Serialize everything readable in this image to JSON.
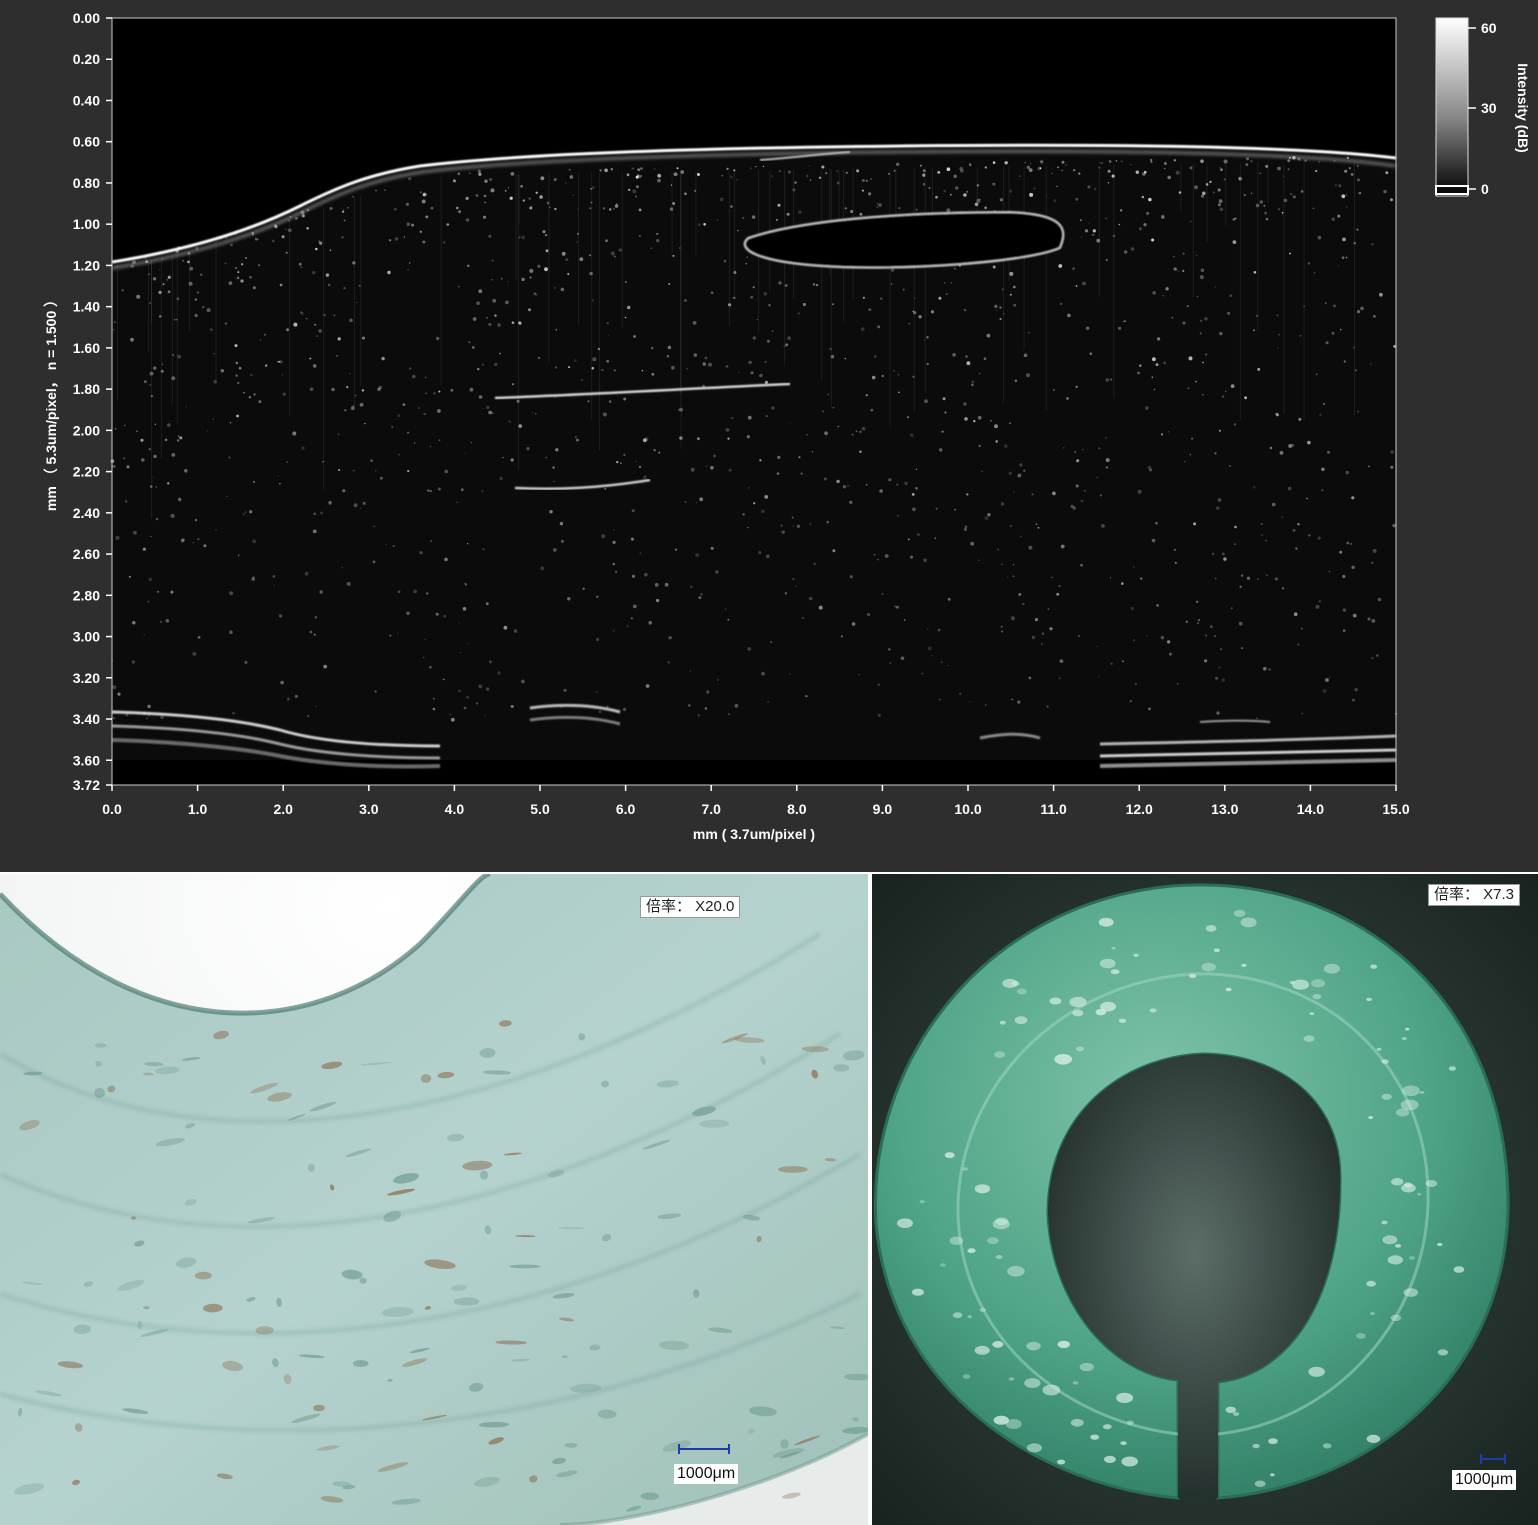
{
  "oct": {
    "y_axis_title": "mm （ 5.3um/pixel， n = 1.500 ）",
    "x_axis_title": "mm ( 3.7um/pixel )",
    "y_ticks": [
      "0.00",
      "0.20",
      "0.40",
      "0.60",
      "0.80",
      "1.00",
      "1.20",
      "1.40",
      "1.60",
      "1.80",
      "2.00",
      "2.20",
      "2.40",
      "2.60",
      "2.80",
      "3.00",
      "3.20",
      "3.40",
      "3.60",
      "3.72"
    ],
    "x_ticks": [
      "0.0",
      "1.0",
      "2.0",
      "3.0",
      "4.0",
      "5.0",
      "6.0",
      "7.0",
      "8.0",
      "9.0",
      "10.0",
      "11.0",
      "12.0",
      "13.0",
      "14.0",
      "15.0"
    ],
    "colorbar": {
      "title": "Intensity (dB)",
      "ticks": [
        "60",
        "30",
        "0"
      ]
    }
  },
  "photo_left": {
    "magnification": "倍率： X20.0",
    "scale_bar": "1000μm"
  },
  "photo_right": {
    "magnification": "倍率： X7.3",
    "scale_bar": "1000μm"
  }
}
